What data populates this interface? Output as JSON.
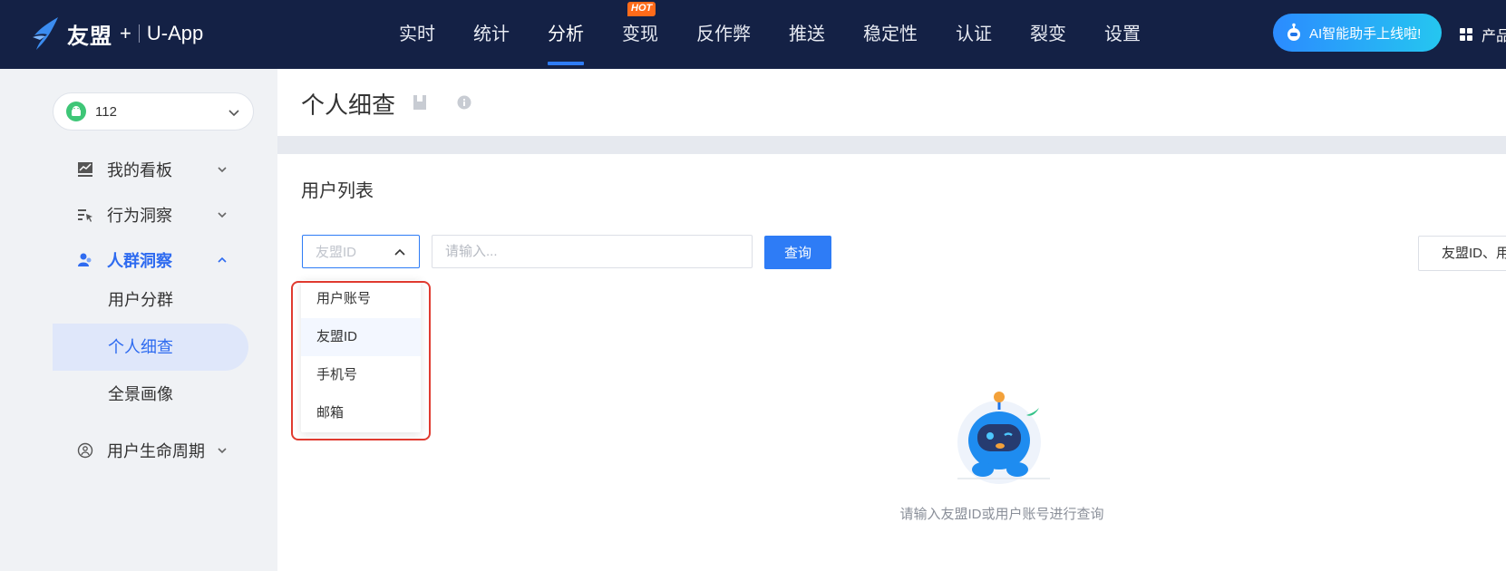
{
  "brand": {
    "name": "友盟",
    "plus": "+",
    "product": "U-App"
  },
  "nav": {
    "items": [
      {
        "label": "实时"
      },
      {
        "label": "统计"
      },
      {
        "label": "分析",
        "active": true
      },
      {
        "label": "变现",
        "badge": "HOT"
      },
      {
        "label": "反作弊"
      },
      {
        "label": "推送"
      },
      {
        "label": "稳定性"
      },
      {
        "label": "认证"
      },
      {
        "label": "裂变"
      },
      {
        "label": "设置"
      }
    ],
    "ai_button": "AI智能助手上线啦!",
    "products": "产品"
  },
  "sidebar": {
    "app_select": "112",
    "menu": [
      {
        "label": "我的看板",
        "icon": "chart-board-icon"
      },
      {
        "label": "行为洞察",
        "icon": "behavior-icon"
      },
      {
        "label": "人群洞察",
        "icon": "users-icon",
        "open": true
      },
      {
        "label": "用户生命周期",
        "icon": "lifecycle-icon"
      }
    ],
    "submenu": [
      {
        "label": "用户分群"
      },
      {
        "label": "个人细查",
        "active": true
      },
      {
        "label": "全景画像"
      }
    ]
  },
  "page": {
    "title": "个人细查"
  },
  "card": {
    "title": "用户列表",
    "type_select_placeholder": "友盟ID",
    "search_placeholder": "请输入...",
    "query_button": "查询",
    "right_chip": "友盟ID、用",
    "dropdown_options": [
      "用户账号",
      "友盟ID",
      "手机号",
      "邮箱"
    ],
    "selected_option": "友盟ID",
    "empty_text": "请输入友盟ID或用户账号进行查询"
  },
  "colors": {
    "topbar": "#142145",
    "primary": "#2e7cf6",
    "highlight": "#e03a2f",
    "hot": "#ff6b1a"
  }
}
